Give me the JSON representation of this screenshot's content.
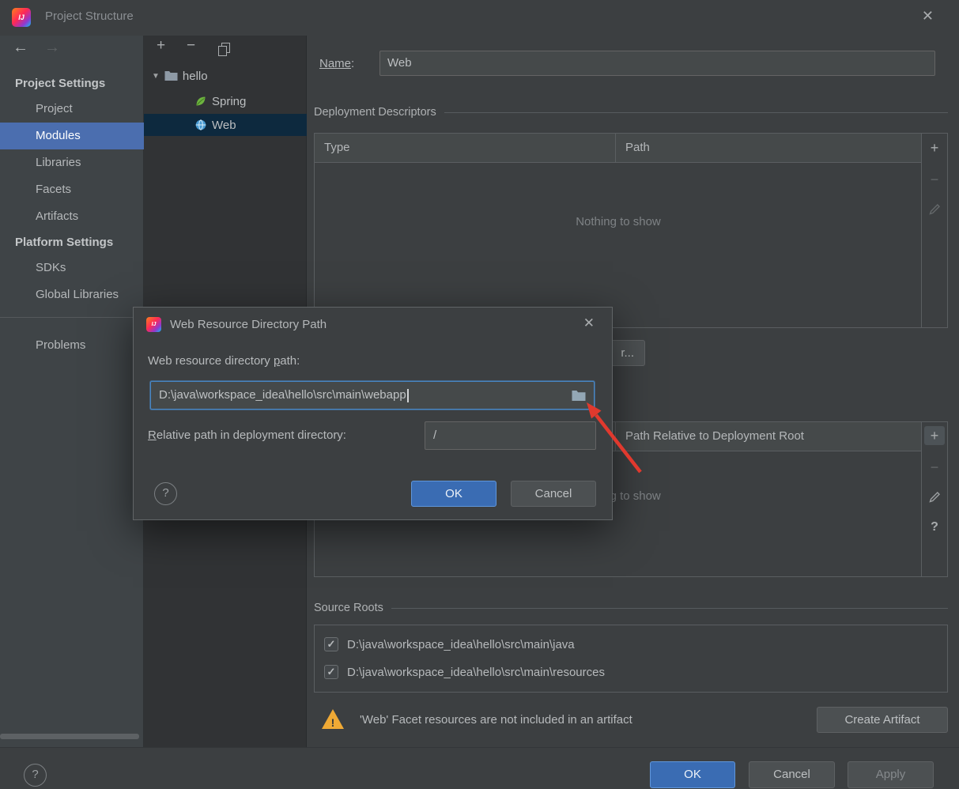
{
  "window": {
    "title": "Project Structure"
  },
  "glyphs": {
    "logo": "IJ",
    "close": "✕",
    "back": "←",
    "forward": "→",
    "plus": "+",
    "minus": "−",
    "expand": "▼",
    "help": "?",
    "check": "✓",
    "warning_mark": "!"
  },
  "sidebar": {
    "sections": [
      {
        "header": "Project Settings",
        "items": [
          "Project",
          "Modules",
          "Libraries",
          "Facets",
          "Artifacts"
        ]
      },
      {
        "header": "Platform Settings",
        "items": [
          "SDKs",
          "Global Libraries"
        ]
      }
    ],
    "problems": "Problems",
    "selected": "Modules"
  },
  "tree": {
    "root": "hello",
    "items": [
      "Spring",
      "Web"
    ],
    "selected": "Web"
  },
  "facet_editor": {
    "name_label": "Name",
    "name_colon": ":",
    "name_value": "Web",
    "deployment": {
      "title": "Deployment Descriptors",
      "col_type": "Type",
      "col_path": "Path",
      "empty": "Nothing to show"
    },
    "covered_button_fragment": "r...",
    "web_resources": {
      "col_path_relative": "Path Relative to Deployment Root",
      "empty": "Nothing to show"
    },
    "source_roots": {
      "title": "Source Roots",
      "items": [
        {
          "path": "D:\\java\\workspace_idea\\hello\\src\\main\\java",
          "checked": true
        },
        {
          "path": "D:\\java\\workspace_idea\\hello\\src\\main\\resources",
          "checked": true
        }
      ]
    },
    "warning": {
      "text": "'Web' Facet resources are not included in an artifact",
      "button": "Create Artifact"
    }
  },
  "dialog": {
    "title": "Web Resource Directory Path",
    "path_label_pre": "Web resource directory ",
    "path_label_mn": "p",
    "path_label_post": "ath:",
    "path_value": "D:\\java\\workspace_idea\\hello\\src\\main\\webapp",
    "relative_label_mn": "R",
    "relative_label_post": "elative path in deployment directory:",
    "relative_value": "/",
    "ok": "OK",
    "cancel": "Cancel"
  },
  "footer": {
    "ok": "OK",
    "cancel": "Cancel",
    "apply": "Apply"
  }
}
